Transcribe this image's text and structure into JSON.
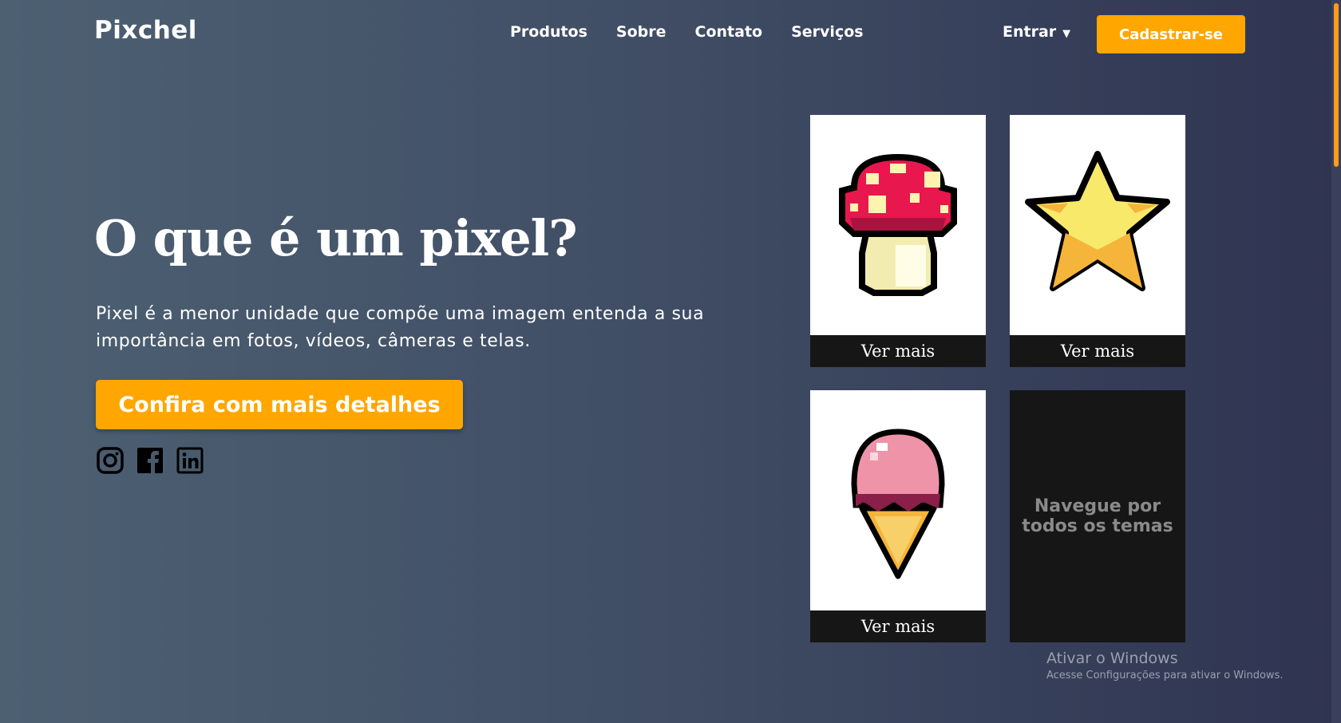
{
  "header": {
    "logo": "Pixchel",
    "nav": [
      "Produtos",
      "Sobre",
      "Contato",
      "Serviços"
    ],
    "login": "Entrar",
    "login_caret": "▼",
    "signup": "Cadastrar-se"
  },
  "hero": {
    "title": "O que é um pixel?",
    "text": "Pixel é a menor unidade que compõe uma imagem entenda a sua importância em fotos, vídeos, câmeras e telas.",
    "cta": "Confira com mais detalhes",
    "social_icons": [
      "instagram-icon",
      "facebook-icon",
      "linkedin-icon"
    ]
  },
  "cards": [
    {
      "icon": "mushroom-icon",
      "label": "Ver mais"
    },
    {
      "icon": "star-icon",
      "label": "Ver mais"
    },
    {
      "icon": "ice-cream-icon",
      "label": "Ver mais"
    }
  ],
  "browse_card": "Navegue por todos os temas",
  "watermark": {
    "title": "Ativar o Windows",
    "subtitle": "Acesse Configurações para ativar o Windows."
  },
  "colors": {
    "accent": "#ffa600",
    "card_footer": "#161616"
  }
}
